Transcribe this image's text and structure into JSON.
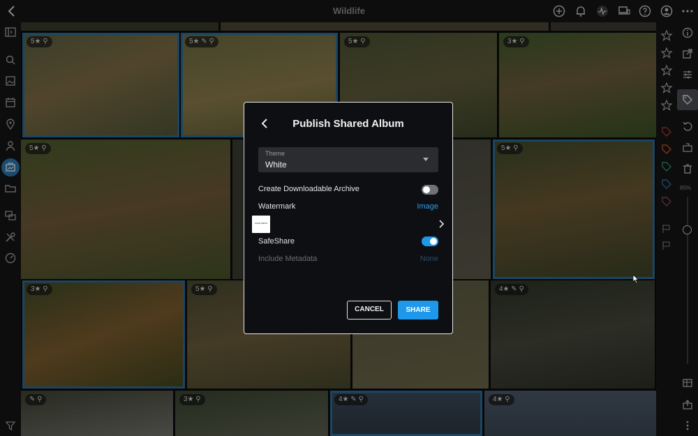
{
  "topbar": {
    "title": "Wildlife",
    "icons": [
      "back-icon",
      "add-icon",
      "bell-icon",
      "activity-icon",
      "devices-icon",
      "help-icon",
      "account-icon",
      "more-icon"
    ]
  },
  "leftbar": {
    "icons": [
      "panel-toggle-icon",
      "search-icon",
      "photos-icon",
      "calendar-icon",
      "location-icon",
      "people-icon",
      "albums-icon",
      "folder-icon",
      "projects-icon",
      "tools-icon",
      "dashboard-icon",
      "filter-icon"
    ]
  },
  "rightbar": {
    "icons": [
      "info-icon",
      "open-icon",
      "adjustments-icon",
      "tag-icon",
      "rotate-icon",
      "move-icon",
      "trash-icon",
      "flag-icon",
      "table-icon",
      "export-icon",
      "more-icon"
    ],
    "zoom_label": "85%",
    "tag_colors": [
      "#b03030",
      "#c05020",
      "#2f8b6a",
      "#2f6d9a",
      "#7a4a4a"
    ]
  },
  "tiles": [
    {
      "badge": "5★ ⚲",
      "selected": true
    },
    {
      "badge": "5★ ✎ ⚲",
      "selected": true
    },
    {
      "badge": "5★ ⚲",
      "selected": false
    },
    {
      "badge": "3★ ⚲",
      "selected": false
    },
    {
      "badge": "5★ ⚲",
      "selected": false
    },
    {
      "badge": "",
      "selected": false
    },
    {
      "badge": "",
      "selected": false
    },
    {
      "badge": "5★ ⚲",
      "selected": true
    },
    {
      "badge": "3★ ⚲",
      "selected": true
    },
    {
      "badge": "5★ ⚲",
      "selected": false
    },
    {
      "badge": "",
      "selected": false
    },
    {
      "badge": "4★ ✎ ⚲",
      "selected": false
    },
    {
      "badge": "✎ ⚲",
      "selected": false
    },
    {
      "badge": "3★ ⚲",
      "selected": false
    },
    {
      "badge": "4★ ✎ ⚲",
      "selected": true
    },
    {
      "badge": "4★ ⚲",
      "selected": false
    }
  ],
  "dialog": {
    "title": "Publish Shared Album",
    "theme_label": "Theme",
    "theme_value": "White",
    "archive_label": "Create Downloadable Archive",
    "archive_on": false,
    "watermark_label": "Watermark",
    "watermark_value": "Image",
    "watermark_thumb_text": "JOHN SMITH",
    "safeshare_label": "SafeShare",
    "safeshare_on": true,
    "metadata_label": "Include Metadata",
    "metadata_value": "None",
    "cancel_label": "CANCEL",
    "share_label": "SHARE"
  },
  "colors": {
    "accent": "#1e98ea",
    "selection": "#2a6c99",
    "dialog_bg": "#0e0f12"
  }
}
